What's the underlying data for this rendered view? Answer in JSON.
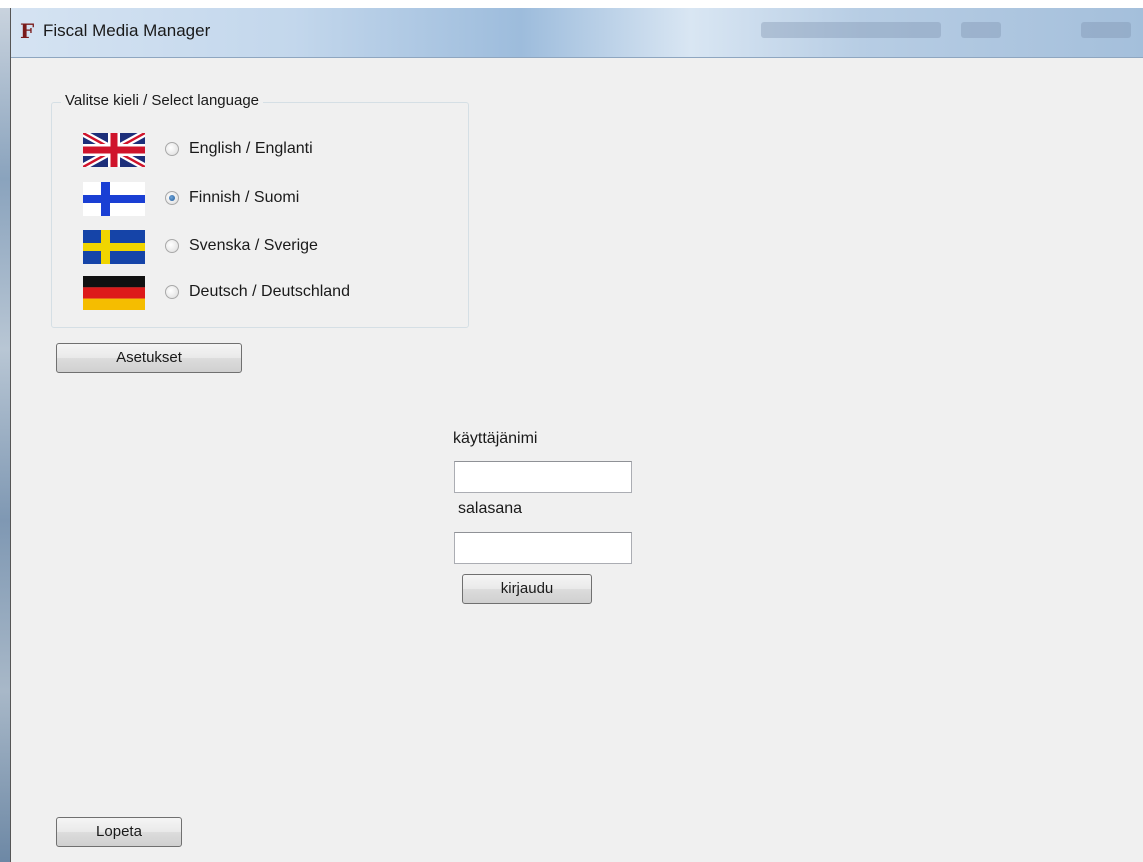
{
  "window": {
    "title": "Fiscal Media Manager",
    "icon_letter": "F"
  },
  "language_group": {
    "legend": "Valitse kieli / Select language",
    "options": [
      {
        "label": "English / Englanti",
        "flag": "uk-flag",
        "checked": false
      },
      {
        "label": "Finnish / Suomi",
        "flag": "finland-flag",
        "checked": true
      },
      {
        "label": "Svenska / Sverige",
        "flag": "sweden-flag",
        "checked": false
      },
      {
        "label": "Deutsch / Deutschland",
        "flag": "germany-flag",
        "checked": false
      }
    ]
  },
  "buttons": {
    "settings": "Asetukset",
    "login": "kirjaudu",
    "quit": "Lopeta"
  },
  "login": {
    "username_label": "käyttäjänimi",
    "username_value": "",
    "password_label": "salasana",
    "password_value": ""
  },
  "colors": {
    "window_bg": "#f0f0f0",
    "finland_blue": "#1a3fd4",
    "sweden_blue": "#1544a8",
    "sweden_yellow": "#f0d500",
    "germany_red": "#dd1a1a",
    "germany_gold": "#f5bd00"
  }
}
